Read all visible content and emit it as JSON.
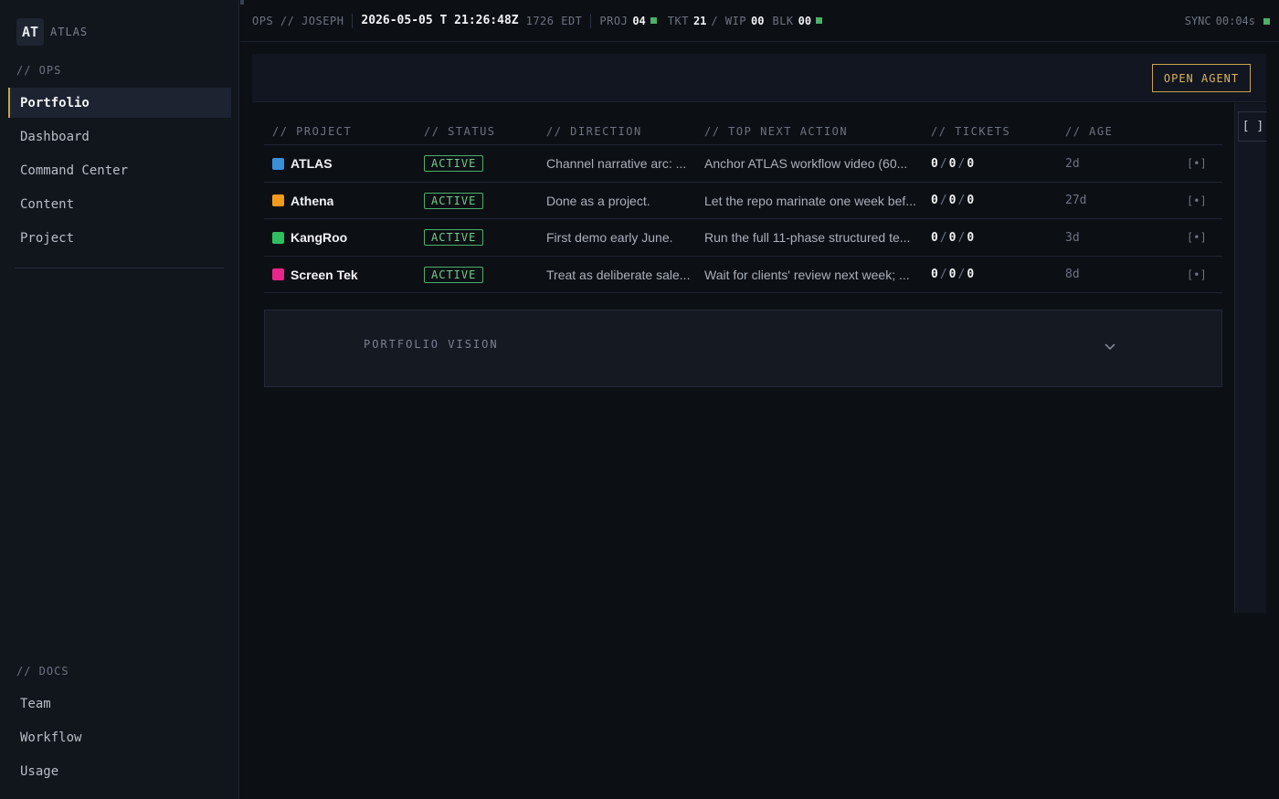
{
  "brand": {
    "badge": "AT",
    "name": "ATLAS"
  },
  "sidebar": {
    "ops_label": "// OPS",
    "ops_items": [
      {
        "label": "Portfolio",
        "active": true
      },
      {
        "label": "Dashboard"
      },
      {
        "label": "Command Center"
      },
      {
        "label": "Content"
      },
      {
        "label": "Project"
      }
    ],
    "docs_label": "// DOCS",
    "docs_items": [
      {
        "label": "Team"
      },
      {
        "label": "Workflow"
      },
      {
        "label": "Usage"
      }
    ]
  },
  "topbar": {
    "context": "OPS // JOSEPH",
    "timestamp": "2026-05-05 T 21:26:48Z",
    "local_time": "1726 EDT",
    "proj_label": "PROJ",
    "proj_value": "04",
    "tkt_label": "TKT",
    "tkt_value": "21",
    "wip_label": "/ WIP",
    "wip_value": "00",
    "blk_label": "BLK",
    "blk_value": "00",
    "sync_label": "SYNC",
    "sync_value": "00:04s"
  },
  "header": {
    "open_agent_label": "OPEN AGENT"
  },
  "rail": {
    "bracket_label": "[ ]"
  },
  "table": {
    "headers": [
      "// PROJECT",
      "// STATUS",
      "// DIRECTION",
      "// TOP NEXT ACTION",
      "// TICKETS",
      "// AGE"
    ],
    "rows": [
      {
        "color": "#3b8fd9",
        "name": "ATLAS",
        "status": "ACTIVE",
        "direction": "Channel narrative arc: ...",
        "next_action": "Anchor ATLAS workflow video (60...",
        "t1": "0",
        "t2": "0",
        "t3": "0",
        "age": "2d",
        "action": "[•]"
      },
      {
        "color": "#f29a1c",
        "name": "Athena",
        "status": "ACTIVE",
        "direction": "Done as a project.",
        "next_action": "Let the repo marinate one week bef...",
        "t1": "0",
        "t2": "0",
        "t3": "0",
        "age": "27d",
        "action": "[•]"
      },
      {
        "color": "#2fbf5f",
        "name": "KangRoo",
        "status": "ACTIVE",
        "direction": "First demo early June.",
        "next_action": "Run the full 11-phase structured te...",
        "t1": "0",
        "t2": "0",
        "t3": "0",
        "age": "3d",
        "action": "[•]"
      },
      {
        "color": "#e8258a",
        "name": "Screen Tek",
        "status": "ACTIVE",
        "direction": "Treat as deliberate sale...",
        "next_action": "Wait for clients' review next week; ...",
        "t1": "0",
        "t2": "0",
        "t3": "0",
        "age": "8d",
        "action": "[•]"
      }
    ]
  },
  "vision": {
    "label": "PORTFOLIO VISION"
  },
  "colors": {
    "accent": "#c8a44e",
    "status_green": "#4caf6a"
  }
}
